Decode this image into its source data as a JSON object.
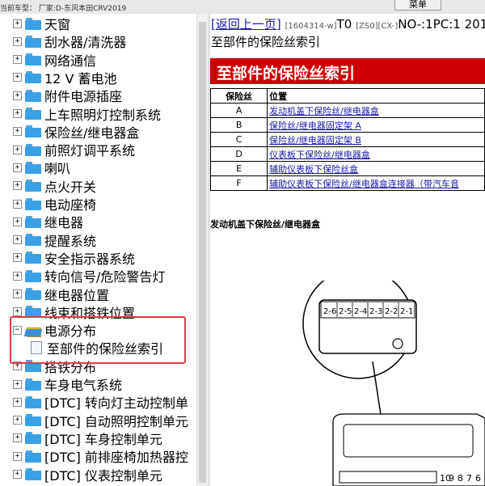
{
  "header": {
    "vehicle_label": "当前车型： 厂家:D-东风本田CRV2019",
    "menu_label": "菜单"
  },
  "tree": {
    "items": [
      {
        "label": "天窗",
        "top": 1
      },
      {
        "label": "刮水器/清洗器"
      },
      {
        "label": "网络通信"
      },
      {
        "label": "12 V 蓄电池"
      },
      {
        "label": "附件电源插座"
      },
      {
        "label": "上车照明灯控制系统"
      },
      {
        "label": "保险丝/继电器盒"
      },
      {
        "label": "前照灯调平系统"
      },
      {
        "label": "喇叭"
      },
      {
        "label": "点火开关"
      },
      {
        "label": "电动座椅"
      },
      {
        "label": "继电器"
      },
      {
        "label": "提醒系统"
      },
      {
        "label": "安全指示器系统"
      },
      {
        "label": "转向信号/危险警告灯"
      },
      {
        "label": "继电器位置"
      },
      {
        "label": "线束和搭铁位置"
      }
    ],
    "expanded": {
      "label": "电源分布",
      "child_label": "至部件的保险丝索引"
    },
    "items_after": [
      {
        "label": "搭铁分布"
      },
      {
        "label": "车身电气系统"
      },
      {
        "label": "[DTC] 转向灯主动控制单"
      },
      {
        "label": "[DTC] 自动照明控制单元"
      },
      {
        "label": "[DTC] 车身控制单元"
      },
      {
        "label": "[DTC] 前排座椅加热器控"
      },
      {
        "label": "[DTC] 仪表控制单元"
      }
    ]
  },
  "content": {
    "back_link": "[返回上一页]",
    "doc_id": "[1604314-w]",
    "code_t0": "T0",
    "code_zs": "[ZS0][CX-]",
    "code_no": "NO-:1PC:1 201",
    "page_subtitle": "至部件的保险丝索引",
    "banner_title": "至部件的保险丝索引",
    "table": {
      "headers": [
        "保险丝",
        "位置"
      ],
      "rows": [
        {
          "fuse": "A",
          "location": "发动机盖下保险丝/继电器盒"
        },
        {
          "fuse": "B",
          "location": "保险丝/继电器固定架 A"
        },
        {
          "fuse": "C",
          "location": "保险丝/继电器固定架 B"
        },
        {
          "fuse": "D",
          "location": "仪表板下保险丝/继电器盒"
        },
        {
          "fuse": "E",
          "location": "辅助仪表板下保险丝盒"
        },
        {
          "fuse": "F",
          "location": "辅助仪表板下保险丝/继电器盒连接器（带汽车音"
        }
      ]
    },
    "section_title": "发动机盖下保险丝/继电器盒",
    "diagram": {
      "pin_labels": [
        "2-6",
        "2-5",
        "2-4",
        "2-3",
        "2-2",
        "2-1"
      ],
      "bottom_pins": [
        "10",
        "9",
        "8",
        "7",
        "6"
      ]
    }
  }
}
